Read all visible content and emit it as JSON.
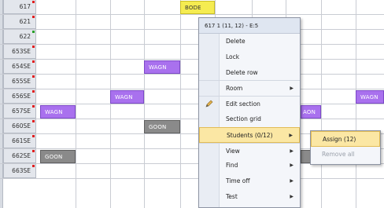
{
  "rows": [
    {
      "label": "617",
      "mark": "#e02020"
    },
    {
      "label": "621",
      "mark": "#e02020"
    },
    {
      "label": "622",
      "mark": "#2aa02a"
    },
    {
      "label": "653SE",
      "mark": "#e02020"
    },
    {
      "label": "654SE",
      "mark": "#e02020"
    },
    {
      "label": "655SE",
      "mark": "#e02020"
    },
    {
      "label": "656SE",
      "mark": "#e02020"
    },
    {
      "label": "657SE",
      "mark": "#e02020"
    },
    {
      "label": "660SE",
      "mark": "#e02020"
    },
    {
      "label": "661SE",
      "mark": "#e02020"
    },
    {
      "label": "662SE",
      "mark": "#e02020"
    },
    {
      "label": "663SE",
      "mark": "#e02020"
    }
  ],
  "blocks": [
    {
      "label": "BODE",
      "color": "yellow"
    },
    {
      "label": "WAGN",
      "color": "purple"
    },
    {
      "label": "WAGN",
      "color": "purple"
    },
    {
      "label": "WAGN",
      "color": "purple"
    },
    {
      "label": "WAGN",
      "color": "purple"
    },
    {
      "label": "GOON",
      "color": "gray"
    },
    {
      "label": "GOON",
      "color": "gray"
    },
    {
      "label": "AON",
      "color": "purple"
    }
  ],
  "context_menu": {
    "title": "617 1 (11, 12) - E:5",
    "items": [
      {
        "label": "Delete",
        "submenu": false
      },
      {
        "label": "Lock",
        "submenu": false
      },
      {
        "label": "Delete row",
        "submenu": false
      },
      {
        "label": "Room",
        "submenu": true
      },
      {
        "label": "Edit section",
        "submenu": false,
        "icon": "pencil-icon"
      },
      {
        "label": "Section grid",
        "submenu": false
      },
      {
        "label": "Students (0/12)",
        "submenu": true,
        "highlighted": true
      },
      {
        "label": "View",
        "submenu": true
      },
      {
        "label": "Find",
        "submenu": true
      },
      {
        "label": "Time off",
        "submenu": true
      },
      {
        "label": "Test",
        "submenu": true
      }
    ]
  },
  "submenu": {
    "items": [
      {
        "label": "Assign (12)",
        "highlighted": true,
        "enabled": true
      },
      {
        "label": "Remove all",
        "highlighted": false,
        "enabled": false
      }
    ]
  },
  "colors": {
    "purple": "#a971ee",
    "gray": "#8a8a8a",
    "yellow": "#f5ec51",
    "highlight": "#fbe7a4"
  }
}
